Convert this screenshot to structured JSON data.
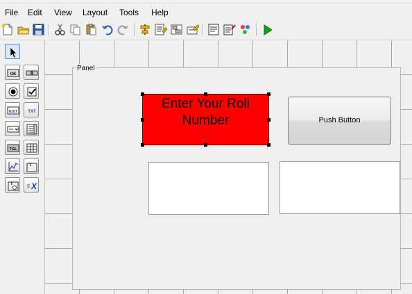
{
  "menu": {
    "items": [
      "File",
      "Edit",
      "View",
      "Layout",
      "Tools",
      "Help"
    ]
  },
  "toolbar": {
    "icons": [
      "new-file-icon",
      "open-folder-icon",
      "save-icon",
      "cut-icon",
      "copy-icon",
      "paste-icon",
      "undo-icon",
      "redo-icon",
      "align-icon",
      "menu-editor-icon",
      "tab-order-icon",
      "toolbar-editor-icon",
      "editor-icon",
      "property-inspector-icon",
      "object-browser-icon",
      "run-icon"
    ]
  },
  "palette": {
    "tools": [
      {
        "name": "select-tool",
        "label": ""
      },
      {
        "name": "push-button-tool",
        "label": "OK"
      },
      {
        "name": "slider-tool",
        "label": ""
      },
      {
        "name": "radio-button-tool",
        "label": ""
      },
      {
        "name": "checkbox-tool",
        "label": ""
      },
      {
        "name": "edit-text-tool",
        "label": "EDIT"
      },
      {
        "name": "static-text-tool",
        "label": "TXT"
      },
      {
        "name": "popup-menu-tool",
        "label": ""
      },
      {
        "name": "listbox-tool",
        "label": ""
      },
      {
        "name": "toggle-button-tool",
        "label": "TGL"
      },
      {
        "name": "table-tool",
        "label": ""
      },
      {
        "name": "axes-tool",
        "label": ""
      },
      {
        "name": "panel-tool",
        "label": "T"
      },
      {
        "name": "button-group-tool",
        "label": "T"
      },
      {
        "name": "activex-tool",
        "label": "X"
      }
    ]
  },
  "canvas": {
    "panel_title": "Panel",
    "static_text": "Enter Your Roll Number",
    "push_button": "Push Button",
    "colors": {
      "static_text_bg": "#ff0000",
      "run_icon": "#1aa01a"
    }
  }
}
